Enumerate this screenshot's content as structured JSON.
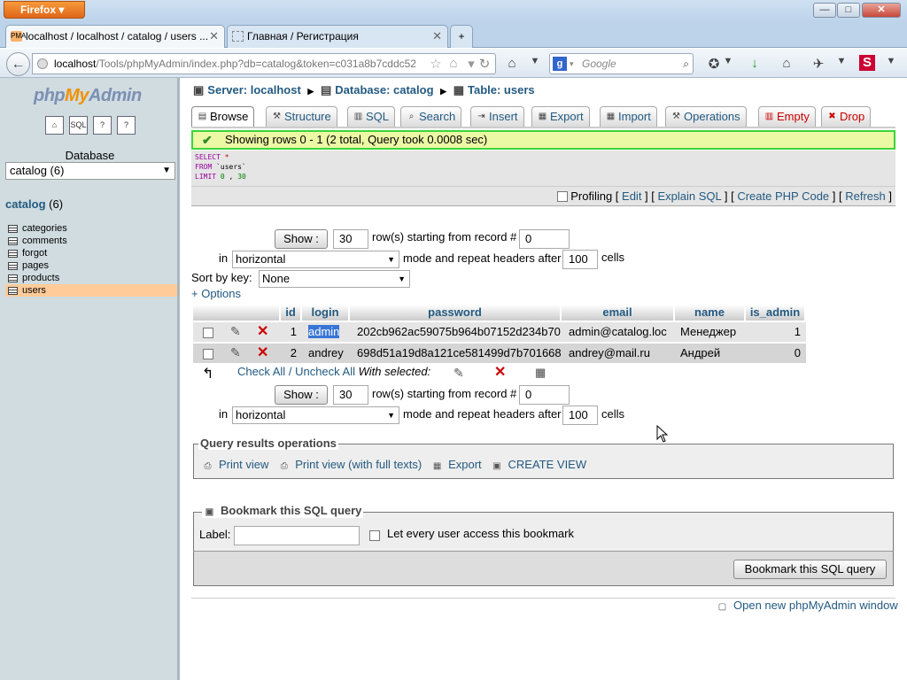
{
  "browser": {
    "app_button": "Firefox",
    "tabs": [
      {
        "title": "localhost / localhost / catalog / users ...",
        "favicon": "PMA"
      },
      {
        "title": "Главная / Регистрация"
      }
    ],
    "new_tab_symbol": "+",
    "url_host": "localhost",
    "url_rest": "/Tools/phpMyAdmin/index.php?db=catalog&token=c031a8b7cddc52",
    "search_placeholder": "Google"
  },
  "sidebar": {
    "logo_php": "php",
    "logo_my": "My",
    "logo_admin": "Admin",
    "quick_icons": [
      "home-icon",
      "sql-icon",
      "docs-icon",
      "help-icon"
    ],
    "database_label": "Database",
    "database_select": "catalog (6)",
    "db_name": "catalog",
    "db_count": "(6)",
    "tables": [
      "categories",
      "comments",
      "forgot",
      "pages",
      "products",
      "users"
    ],
    "active_table": "users"
  },
  "breadcrumb": {
    "server": "Server: localhost",
    "database": "Database: catalog",
    "table": "Table: users"
  },
  "tabs": [
    {
      "label": "Browse",
      "icon": "browse-icon",
      "active": true
    },
    {
      "label": "Structure",
      "icon": "structure-icon"
    },
    {
      "label": "SQL",
      "icon": "sql-icon"
    },
    {
      "label": "Search",
      "icon": "search-icon"
    },
    {
      "label": "Insert",
      "icon": "insert-icon"
    },
    {
      "label": "Export",
      "icon": "export-icon"
    },
    {
      "label": "Import",
      "icon": "import-icon"
    },
    {
      "label": "Operations",
      "icon": "operations-icon"
    },
    {
      "label": "Empty",
      "icon": "empty-icon",
      "danger": true
    },
    {
      "label": "Drop",
      "icon": "drop-icon",
      "danger": true
    }
  ],
  "success_message": "Showing rows 0 - 1 (2 total, Query took 0.0008 sec)",
  "query": {
    "line1_kw": "SELECT",
    "line1_rest": " *",
    "line2_kw": "FROM",
    "line2_rest": " `users`",
    "line3_kw": "LIMIT",
    "line3_a": " 0",
    "line3_sep": " , ",
    "line3_b": "30"
  },
  "query_links": {
    "profiling": "Profiling",
    "edit": "Edit",
    "explain": "Explain SQL",
    "create_php": "Create PHP Code",
    "refresh": "Refresh"
  },
  "nav_top": {
    "show_button": "Show :",
    "rows": "30",
    "rows_label": "row(s) starting from record #",
    "start": "0",
    "in_label": "in",
    "mode": "horizontal",
    "mode_label": "mode and repeat headers after",
    "repeat": "100",
    "cells_label": "cells"
  },
  "sort": {
    "label": "Sort by key:",
    "value": "None"
  },
  "options_link": "+ Options",
  "table": {
    "columns": [
      "id",
      "login",
      "password",
      "email",
      "name",
      "is_admin"
    ],
    "rows": [
      [
        "1",
        "admin",
        "202cb962ac59075b964b07152d234b70",
        "admin@catalog.loc",
        "Менеджер",
        "1"
      ],
      [
        "2",
        "andrey",
        "698d51a19d8a121ce581499d7b701668",
        "andrey@mail.ru",
        "Андрей",
        "0"
      ]
    ]
  },
  "bulk": {
    "check_all": "Check All",
    "separator": "/",
    "uncheck_all": "Uncheck All",
    "with_selected": "With selected:"
  },
  "nav_bottom": {
    "show_button": "Show :",
    "rows": "30",
    "rows_label": "row(s) starting from record #",
    "start": "0",
    "in_label": "in",
    "mode": "horizontal",
    "mode_label": "mode and repeat headers after",
    "repeat": "100",
    "cells_label": "cells"
  },
  "query_ops": {
    "legend": "Query results operations",
    "print_view": "Print view",
    "print_full": "Print view (with full texts)",
    "export": "Export",
    "create_view": "CREATE VIEW"
  },
  "bookmark": {
    "legend": "Bookmark this SQL query",
    "label": "Label:",
    "label_value": "",
    "share": "Let every user access this bookmark",
    "button": "Bookmark this SQL query"
  },
  "open_new_window": "Open new phpMyAdmin window"
}
